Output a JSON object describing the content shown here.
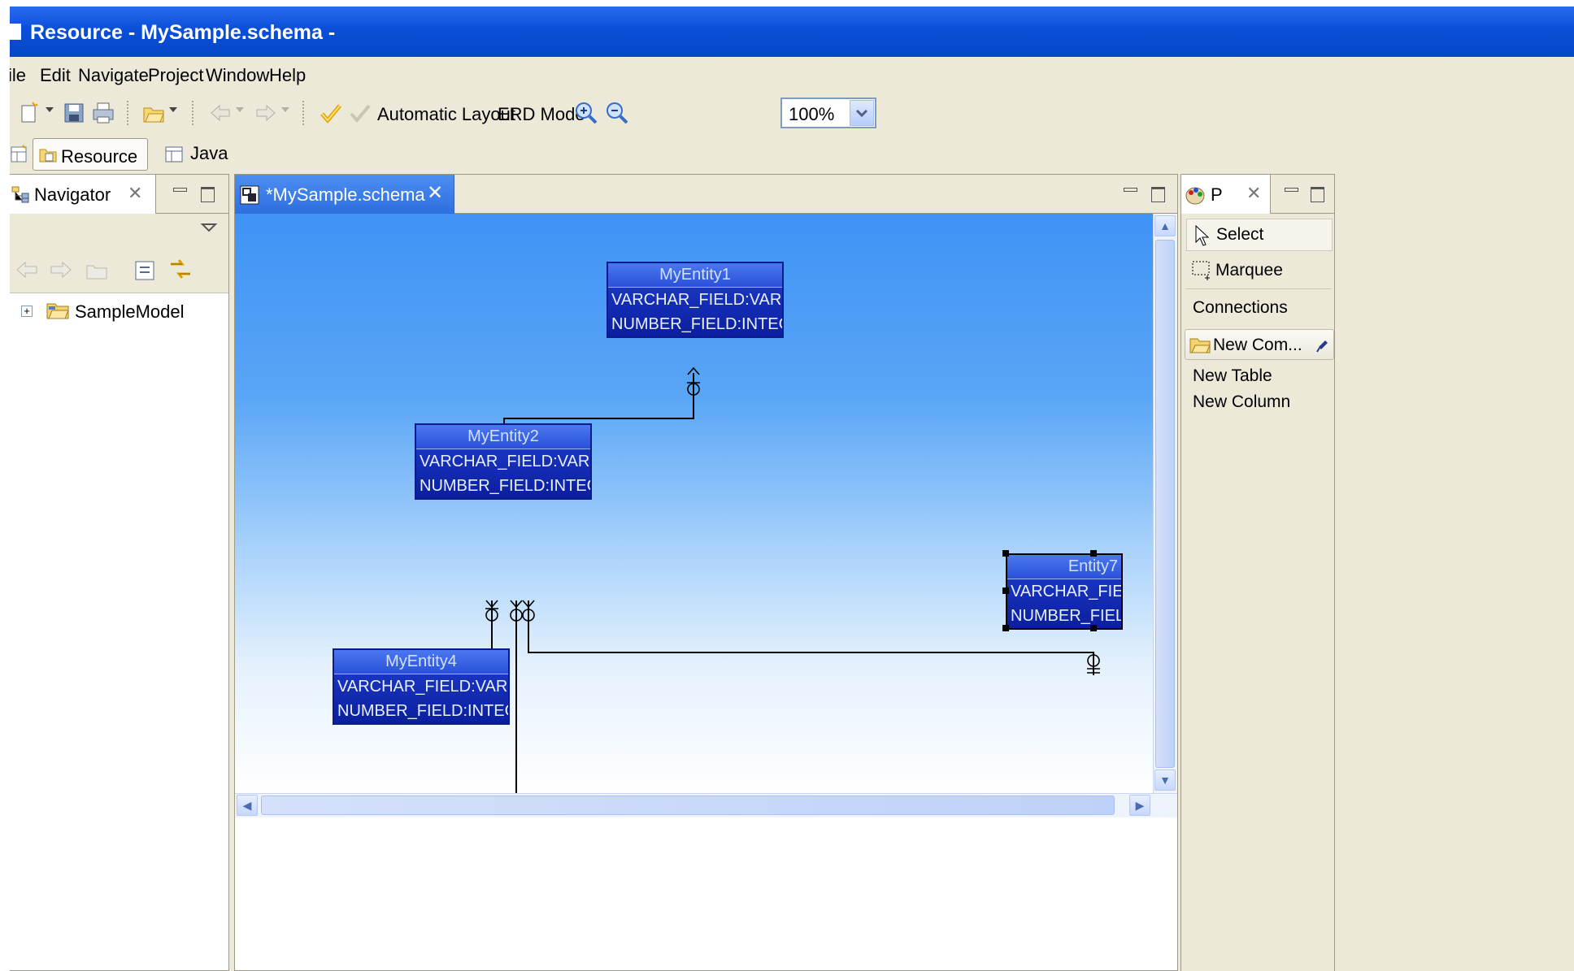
{
  "window": {
    "title": "Resource - MySample.schema -"
  },
  "menu": {
    "items": [
      "File",
      "Edit",
      "Navigate",
      "Project",
      "Window",
      "Help"
    ],
    "file_visible": "ile"
  },
  "toolbar": {
    "automatic_layout": "Automatic Layout",
    "erd_mode": "ERD Mode",
    "zoom_value": "100%"
  },
  "perspectives": {
    "resource": "Resource",
    "java": "Java"
  },
  "navigator": {
    "title": "Navigator",
    "tree": [
      {
        "label": "SampleModel",
        "expanded": false
      }
    ]
  },
  "editor": {
    "tab_title": "*MySample.schema",
    "entities": [
      {
        "id": "e1",
        "name": "MyEntity1",
        "fields": [
          "VARCHAR_FIELD:VARCHAR",
          "NUMBER_FIELD:INTEGER"
        ]
      },
      {
        "id": "e2",
        "name": "MyEntity2",
        "fields": [
          "VARCHAR_FIELD:VARCHAR",
          "NUMBER_FIELD:INTEGER"
        ]
      },
      {
        "id": "e4",
        "name": "MyEntity4",
        "fields": [
          "VARCHAR_FIELD:VARCHAR",
          "NUMBER_FIELD:INTEGER"
        ]
      },
      {
        "id": "e7",
        "name": "Entity7",
        "fields": [
          "VARCHAR_FIELD:",
          "NUMBER_FIELD:IN"
        ]
      }
    ]
  },
  "palette": {
    "title": "P",
    "select": "Select",
    "marquee": "Marquee",
    "connections": "Connections",
    "drawer": "New Com...",
    "items": [
      "New Table",
      "New Column"
    ]
  },
  "colors": {
    "titlebar": "#0a4fd8",
    "canvas_top": "#3f93f5",
    "entity": "#1030b8"
  }
}
